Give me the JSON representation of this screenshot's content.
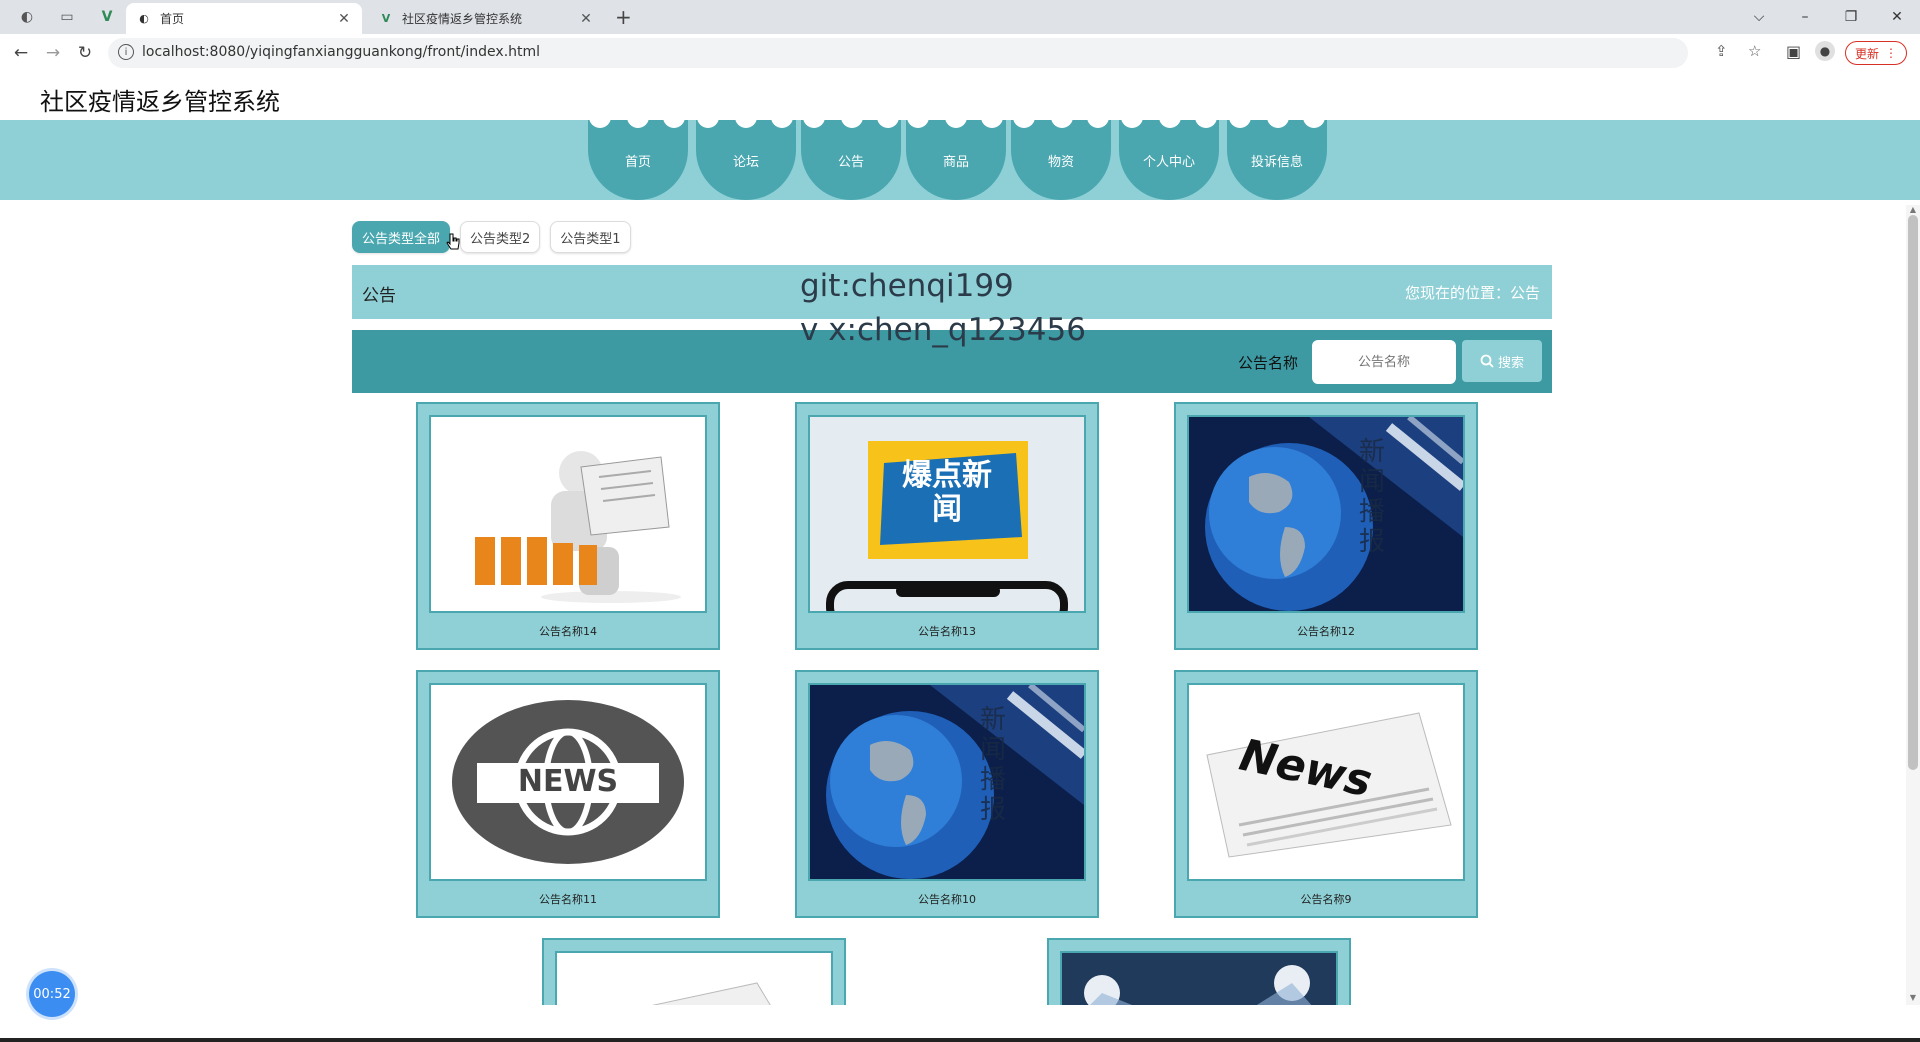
{
  "browser": {
    "tabs": [
      {
        "title": "首页",
        "active": true
      },
      {
        "title": "社区疫情返乡管控系统",
        "active": false
      }
    ],
    "new_tab": "+",
    "url": "localhost:8080/yiqingfanxiangguankong/front/index.html",
    "update_label": "更新",
    "win_min": "–",
    "win_restore": "❐",
    "win_close": "✕",
    "tab_list": "⌵"
  },
  "site": {
    "title": "社区疫情返乡管控系统",
    "nav": [
      "首页",
      "论坛",
      "公告",
      "商品",
      "物资",
      "个人中心",
      "投诉信息"
    ]
  },
  "filters": {
    "chips": [
      "公告类型全部",
      "公告类型2",
      "公告类型1"
    ],
    "active_index": 0
  },
  "breadcrumb": {
    "title": "公告",
    "location": "您现在的位置：公告"
  },
  "watermark": {
    "line1": "git:chenqi199",
    "line2": "v x:chen_q123456"
  },
  "search": {
    "label": "公告名称",
    "placeholder": "公告名称",
    "button": "搜索"
  },
  "cards": [
    {
      "caption": "公告名称14",
      "image": "news-reader-figure"
    },
    {
      "caption": "公告名称13",
      "image": "breaking-news-phone",
      "image_text": "爆点新闻"
    },
    {
      "caption": "公告名称12",
      "image": "globe-news-broadcast",
      "image_text": "新闻播报"
    },
    {
      "caption": "公告名称11",
      "image": "news-globe-badge",
      "image_text": "NEWS"
    },
    {
      "caption": "公告名称10",
      "image": "globe-news-broadcast",
      "image_text": "新闻播报"
    },
    {
      "caption": "公告名称9",
      "image": "news-newspaper",
      "image_text": "News"
    }
  ],
  "timer": "00:52",
  "colors": {
    "nav_band": "#8fd0d6",
    "nav_item": "#4aa7b0",
    "search_bar": "#3d9aa3",
    "card_bg": "#8fd0d6"
  }
}
